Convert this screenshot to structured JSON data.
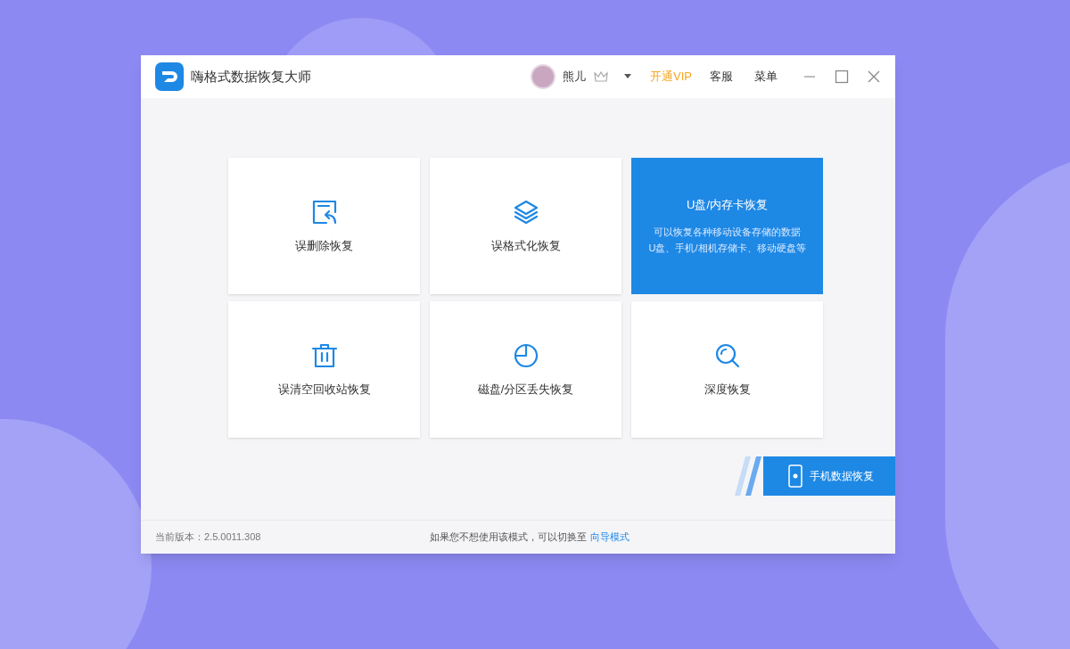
{
  "window": {
    "title": "嗨格式数据恢复大师"
  },
  "header": {
    "user": "熊儿",
    "vip": "开通VIP",
    "service": "客服",
    "menu": "菜单"
  },
  "cards": [
    {
      "label": "误删除恢复",
      "selected": false
    },
    {
      "label": "误格式化恢复",
      "selected": false
    },
    {
      "label": "U盘/内存卡恢复",
      "selected": true,
      "description": [
        "可以恢复各种移动设备存储的数据",
        "U盘、手机/相机存储卡、移动硬盘等"
      ]
    },
    {
      "label": "误清空回收站恢复",
      "selected": false
    },
    {
      "label": "磁盘/分区丢失恢复",
      "selected": false
    },
    {
      "label": "深度恢复",
      "selected": false
    }
  ],
  "mobile_button": "手机数据恢复",
  "status_bar": {
    "version": "当前版本：2.5.0011.308",
    "hint": "如果您不想使用该模式，可以切换至",
    "link": "向导模式"
  }
}
